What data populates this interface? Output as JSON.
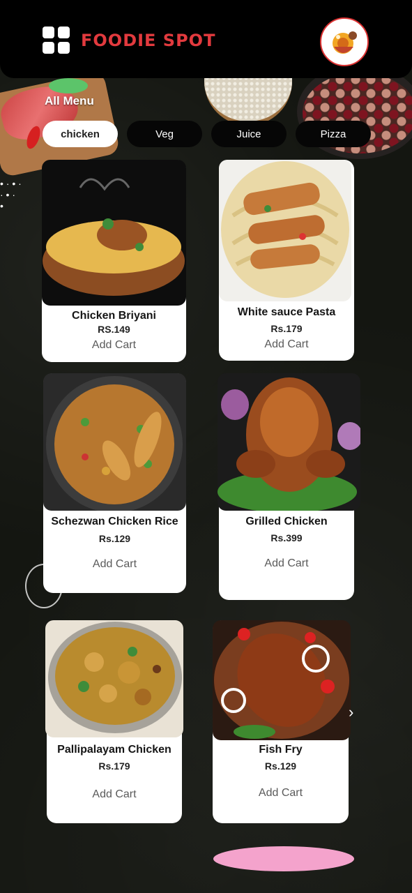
{
  "header": {
    "brand": "FOODIE SPOT",
    "menu_icon": "grid-menu-icon",
    "logo_icon": "brand-logo-icon"
  },
  "section": {
    "title": "All Menu"
  },
  "tabs": [
    {
      "label": "chicken",
      "active": true
    },
    {
      "label": "Veg",
      "active": false
    },
    {
      "label": "Juice",
      "active": false
    },
    {
      "label": "Pizza",
      "active": false
    }
  ],
  "items": [
    {
      "name": "Chicken Briyani",
      "price": "RS.149",
      "action": "Add Cart"
    },
    {
      "name": "White sauce Pasta",
      "price": "Rs.179",
      "action": "Add Cart"
    },
    {
      "name": "Schezwan Chicken Rice",
      "price": "Rs.129",
      "action": "Add Cart"
    },
    {
      "name": "Grilled Chicken",
      "price": "Rs.399",
      "action": "Add Cart"
    },
    {
      "name": "Pallipalayam Chicken",
      "price": "Rs.179",
      "action": "Add Cart"
    },
    {
      "name": "Fish Fry",
      "price": "Rs.129",
      "action": "Add Cart"
    }
  ],
  "colors": {
    "brand": "#e23a3e",
    "background": "#151712",
    "card": "#ffffff",
    "fab": "#f4a3cc"
  }
}
